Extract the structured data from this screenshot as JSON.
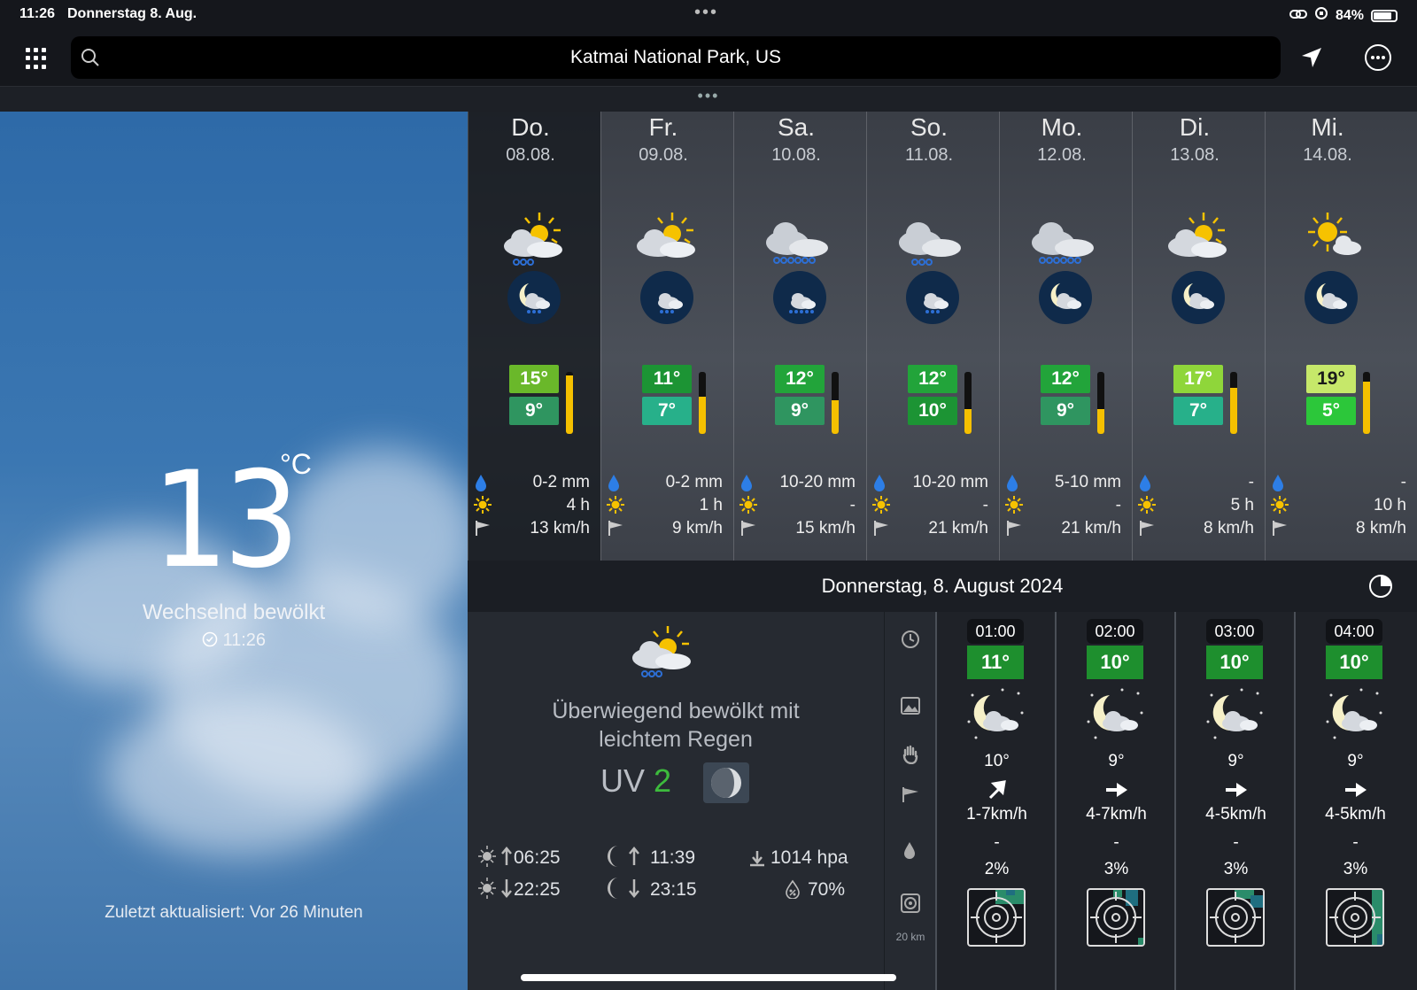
{
  "status_bar": {
    "time": "11:26",
    "date": "Donnerstag 8. Aug.",
    "battery": "84%",
    "dots": "•••"
  },
  "search": {
    "location": "Katmai National Park, US"
  },
  "handle": "•••",
  "current": {
    "temperature": "13",
    "unit": "°C",
    "condition": "Wechselnd bewölkt",
    "time": "11:26",
    "updated": "Zuletzt aktualisiert: Vor 26 Minuten"
  },
  "days": [
    {
      "name": "Do.",
      "date": "08.08.",
      "high": "15°",
      "low": "9°",
      "high_color": "#6ab82a",
      "low_color": "#2f9560",
      "bar_fill": 0.95,
      "precip": "0-2 mm",
      "sun": "4 h",
      "wind": "13 km/h",
      "day_icon": "sun-cloud-rain-icon",
      "night_icon": "moon-cloud-rain-icon",
      "active": true
    },
    {
      "name": "Fr.",
      "date": "09.08.",
      "high": "11°",
      "low": "7°",
      "high_color": "#1c9434",
      "low_color": "#27b08a",
      "bar_fill": 0.6,
      "precip": "0-2 mm",
      "sun": "1 h",
      "wind": "9 km/h",
      "day_icon": "sun-cloud-icon",
      "night_icon": "cloud-rain-night-icon",
      "active": false
    },
    {
      "name": "Sa.",
      "date": "10.08.",
      "high": "12°",
      "low": "9°",
      "high_color": "#22a43a",
      "low_color": "#2f9560",
      "bar_fill": 0.55,
      "precip": "10-20 mm",
      "sun": "-",
      "wind": "15 km/h",
      "day_icon": "cloud-heavy-rain-icon",
      "night_icon": "cloud-heavy-rain-night-icon",
      "active": false
    },
    {
      "name": "So.",
      "date": "11.08.",
      "high": "12°",
      "low": "10°",
      "high_color": "#22a43a",
      "low_color": "#1c9434",
      "bar_fill": 0.4,
      "precip": "10-20 mm",
      "sun": "-",
      "wind": "21 km/h",
      "day_icon": "cloud-rain-icon",
      "night_icon": "cloud-rain-night-icon",
      "active": false
    },
    {
      "name": "Mo.",
      "date": "12.08.",
      "high": "12°",
      "low": "9°",
      "high_color": "#22a43a",
      "low_color": "#2f9560",
      "bar_fill": 0.4,
      "precip": "5-10 mm",
      "sun": "-",
      "wind": "21 km/h",
      "day_icon": "cloud-heavy-rain-icon",
      "night_icon": "moon-cloud-icon",
      "active": false
    },
    {
      "name": "Di.",
      "date": "13.08.",
      "high": "17°",
      "low": "7°",
      "high_color": "#8fd63a",
      "low_color": "#27b08a",
      "bar_fill": 0.75,
      "precip": "-",
      "sun": "5 h",
      "wind": "8 km/h",
      "day_icon": "sun-cloud-icon",
      "night_icon": "moon-cloud-icon",
      "active": false
    },
    {
      "name": "Mi.",
      "date": "14.08.",
      "high": "19°",
      "low": "5°",
      "high_color": "#c6e86a",
      "low_color": "#2cc73a",
      "bar_fill": 0.85,
      "precip": "-",
      "sun": "10 h",
      "wind": "8 km/h",
      "day_icon": "sun-small-cloud-icon",
      "night_icon": "moon-cloud-icon",
      "active": false
    }
  ],
  "detail": {
    "title": "Donnerstag, 8. August 2024",
    "condition_line1": "Überwiegend bewölkt mit",
    "condition_line2": "leichtem Regen",
    "uv_label": "UV",
    "uv_value": "2",
    "sunrise": "06:25",
    "sunset": "22:25",
    "moonrise": "11:39",
    "moonset": "23:15",
    "pressure": "1014 hpa",
    "humidity": "70%",
    "radar_scale": "20 km"
  },
  "hours": [
    {
      "time": "01:00",
      "temp": "11°",
      "feel": "10°",
      "wind": "1-7km/h",
      "precip": "-",
      "prob": "2%",
      "arrow": "arrow-northeast-icon"
    },
    {
      "time": "02:00",
      "temp": "10°",
      "feel": "9°",
      "wind": "4-7km/h",
      "precip": "-",
      "prob": "3%",
      "arrow": "arrow-east-icon"
    },
    {
      "time": "03:00",
      "temp": "10°",
      "feel": "9°",
      "wind": "4-5km/h",
      "precip": "-",
      "prob": "3%",
      "arrow": "arrow-east-icon"
    },
    {
      "time": "04:00",
      "temp": "10°",
      "feel": "9°",
      "wind": "4-5km/h",
      "precip": "-",
      "prob": "3%",
      "arrow": "arrow-east-icon"
    }
  ]
}
